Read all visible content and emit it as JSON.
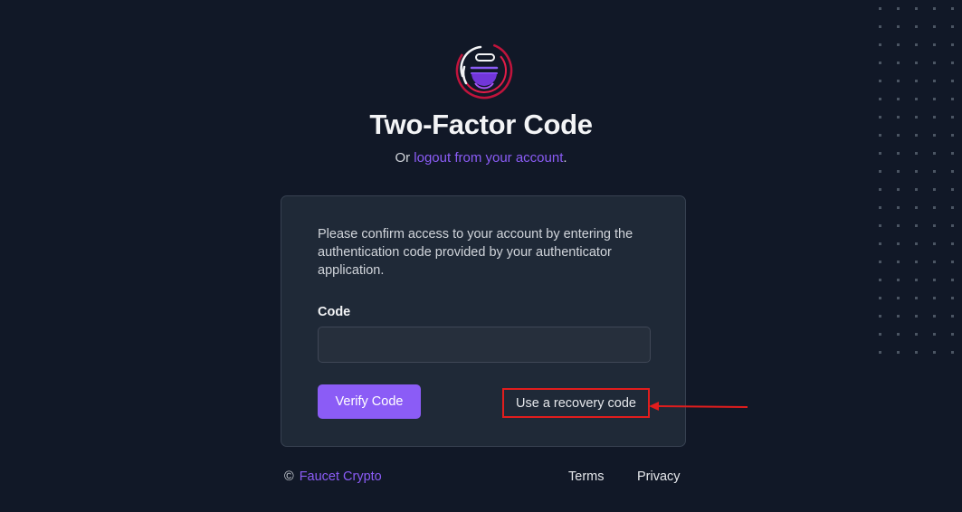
{
  "header": {
    "title": "Two-Factor Code",
    "subtitle_prefix": "Or ",
    "logout_link": "logout from your account",
    "subtitle_suffix": "."
  },
  "card": {
    "intro": "Please confirm access to your account by entering the authentication code provided by your authenticator application.",
    "code_label": "Code",
    "code_value": "",
    "verify_label": "Verify Code",
    "recovery_label": "Use a recovery code"
  },
  "footer": {
    "copyright_symbol": "©",
    "brand": "Faucet Crypto",
    "links": [
      "Terms",
      "Privacy"
    ]
  },
  "colors": {
    "background": "#111827",
    "card": "#1f2937",
    "accent": "#8b5cf6",
    "highlight": "#e11d1d"
  },
  "icons": {
    "logo": "faucet-crypto-logo",
    "annotation_arrow": "red-arrow-left"
  }
}
